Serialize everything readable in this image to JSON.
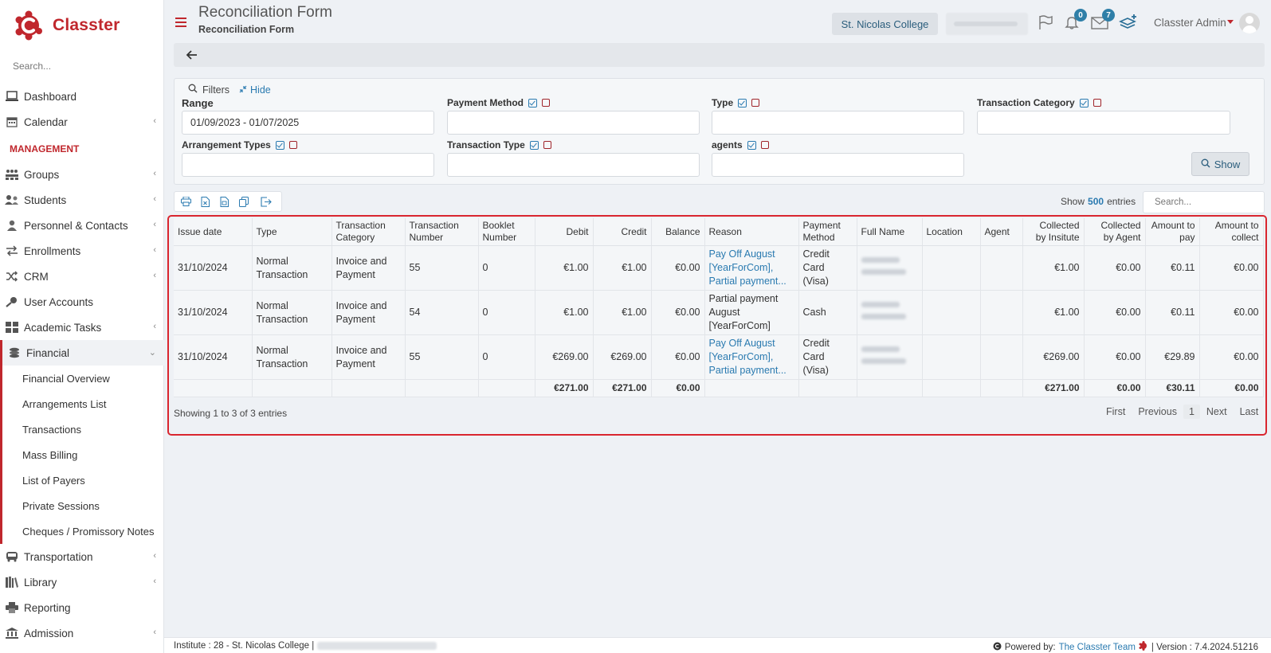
{
  "app": {
    "name": "Classter",
    "brand_color": "#c0272d",
    "accent_color": "#2a7ab0"
  },
  "sidebar": {
    "search_placeholder": "Search...",
    "top_items": [
      {
        "label": "Dashboard",
        "icon": "laptop-icon"
      },
      {
        "label": "Calendar",
        "icon": "calendar-icon"
      }
    ],
    "section": "MANAGEMENT",
    "items": [
      {
        "label": "Groups",
        "icon": "groups-icon"
      },
      {
        "label": "Students",
        "icon": "students-icon"
      },
      {
        "label": "Personnel & Contacts",
        "icon": "person-icon"
      },
      {
        "label": "Enrollments",
        "icon": "swap-icon"
      },
      {
        "label": "CRM",
        "icon": "shuffle-icon"
      },
      {
        "label": "User Accounts",
        "icon": "key-icon"
      },
      {
        "label": "Academic Tasks",
        "icon": "grid-icon"
      },
      {
        "label": "Financial",
        "icon": "coins-icon"
      }
    ],
    "financial_sub": [
      "Financial Overview",
      "Arrangements List",
      "Transactions",
      "Mass Billing",
      "List of Payers",
      "Private Sessions",
      "Cheques / Promissory Notes"
    ],
    "bottom_items": [
      {
        "label": "Transportation",
        "icon": "bus-icon"
      },
      {
        "label": "Library",
        "icon": "books-icon"
      },
      {
        "label": "Reporting",
        "icon": "printer-icon"
      },
      {
        "label": "Admission",
        "icon": "institution-icon"
      }
    ]
  },
  "header": {
    "title": "Reconciliation Form",
    "subtitle": "Reconciliation Form",
    "college": "St. Nicolas College",
    "notifications_count": "0",
    "messages_count": "7",
    "user": "Classter Admin"
  },
  "filters": {
    "title": "Filters",
    "hide": "Hide",
    "range_label": "Range",
    "range_value": "01/09/2023 - 01/07/2025",
    "payment_method": "Payment Method",
    "type": "Type",
    "transaction_category": "Transaction Category",
    "arrangement_types": "Arrangement Types",
    "transaction_type": "Transaction Type",
    "agents": "agents",
    "show_button": "Show"
  },
  "table_controls": {
    "show": "Show",
    "entries_count": "500",
    "entries": "entries",
    "search_placeholder": "Search..."
  },
  "table": {
    "columns": [
      "Issue date",
      "Type",
      "Transaction Category",
      "Transaction Number",
      "Booklet Number",
      "Debit",
      "Credit",
      "Balance",
      "Reason",
      "Payment Method",
      "Full Name",
      "Location",
      "Agent",
      "Collected by Insitute",
      "Collected by Agent",
      "Amount to pay",
      "Amount to collect"
    ],
    "rows": [
      {
        "issue_date": "31/10/2024",
        "type": "Normal Transaction",
        "category": "Invoice and Payment",
        "number": "55",
        "booklet": "0",
        "debit": "€1.00",
        "credit": "€1.00",
        "balance": "€0.00",
        "reason": "Pay Off August [YearForCom], Partial payment...",
        "reason_link": true,
        "method": "Credit Card (Visa)",
        "location": "",
        "agent": "",
        "coll_inst": "€1.00",
        "coll_agent": "€0.00",
        "to_pay": "€0.11",
        "to_collect": "€0.00"
      },
      {
        "issue_date": "31/10/2024",
        "type": "Normal Transaction",
        "category": "Invoice and Payment",
        "number": "54",
        "booklet": "0",
        "debit": "€1.00",
        "credit": "€1.00",
        "balance": "€0.00",
        "reason": "Partial payment August [YearForCom]",
        "reason_link": false,
        "method": "Cash",
        "location": "",
        "agent": "",
        "coll_inst": "€1.00",
        "coll_agent": "€0.00",
        "to_pay": "€0.11",
        "to_collect": "€0.00"
      },
      {
        "issue_date": "31/10/2024",
        "type": "Normal Transaction",
        "category": "Invoice and Payment",
        "number": "55",
        "booklet": "0",
        "debit": "€269.00",
        "credit": "€269.00",
        "balance": "€0.00",
        "reason": "Pay Off August [YearForCom], Partial payment...",
        "reason_link": true,
        "method": "Credit Card (Visa)",
        "location": "",
        "agent": "",
        "coll_inst": "€269.00",
        "coll_agent": "€0.00",
        "to_pay": "€29.89",
        "to_collect": "€0.00"
      }
    ],
    "totals": {
      "debit": "€271.00",
      "credit": "€271.00",
      "balance": "€0.00",
      "coll_inst": "€271.00",
      "coll_agent": "€0.00",
      "to_pay": "€30.11",
      "to_collect": "€0.00"
    },
    "showing": "Showing 1 to 3 of 3 entries",
    "pager": {
      "first": "First",
      "previous": "Previous",
      "page": "1",
      "next": "Next",
      "last": "Last"
    }
  },
  "footer": {
    "institute": "Institute : 28 - St. Nicolas College |",
    "powered_by": "Powered by:",
    "team": "The Classter Team",
    "version": "| Version : 7.4.2024.51216"
  }
}
